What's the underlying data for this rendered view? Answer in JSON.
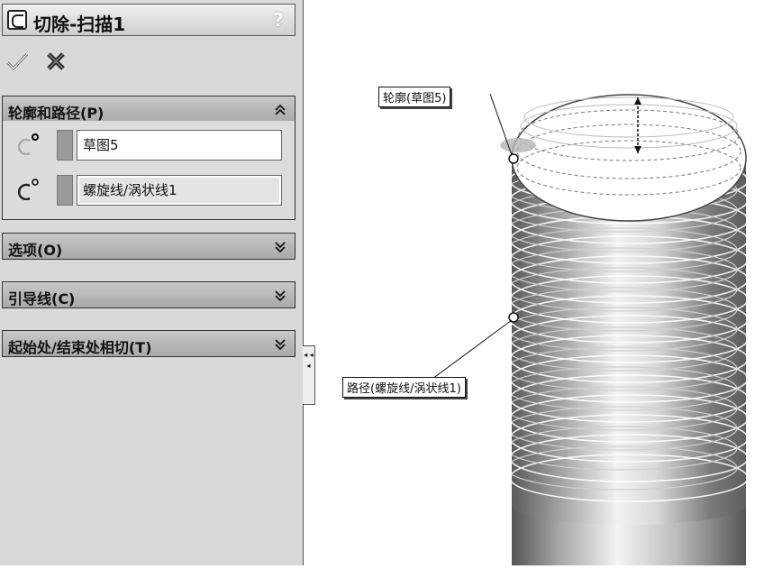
{
  "feature_title": "切除-扫描1",
  "help_glyph": "?",
  "sections": {
    "profile_path": {
      "header": "轮廓和路径(P)",
      "profile_value": "草图5",
      "path_value": "螺旋线/涡状线1"
    },
    "options": {
      "header": "选项(O)"
    },
    "guide_curves": {
      "header": "引导线(C)"
    },
    "tangency": {
      "header": "起始处/结束处相切(T)"
    }
  },
  "callouts": {
    "profile": "轮廓(草图5)",
    "path": "路径(螺旋线/涡状线1)"
  },
  "collapse_glyphs": "◂ ◂ ◂",
  "icons": [
    "feature-icon",
    "help-icon",
    "ok-checkmark-icon",
    "cancel-x-icon",
    "collapse-up-icon",
    "expand-down-icon",
    "profile-icon",
    "path-icon"
  ]
}
